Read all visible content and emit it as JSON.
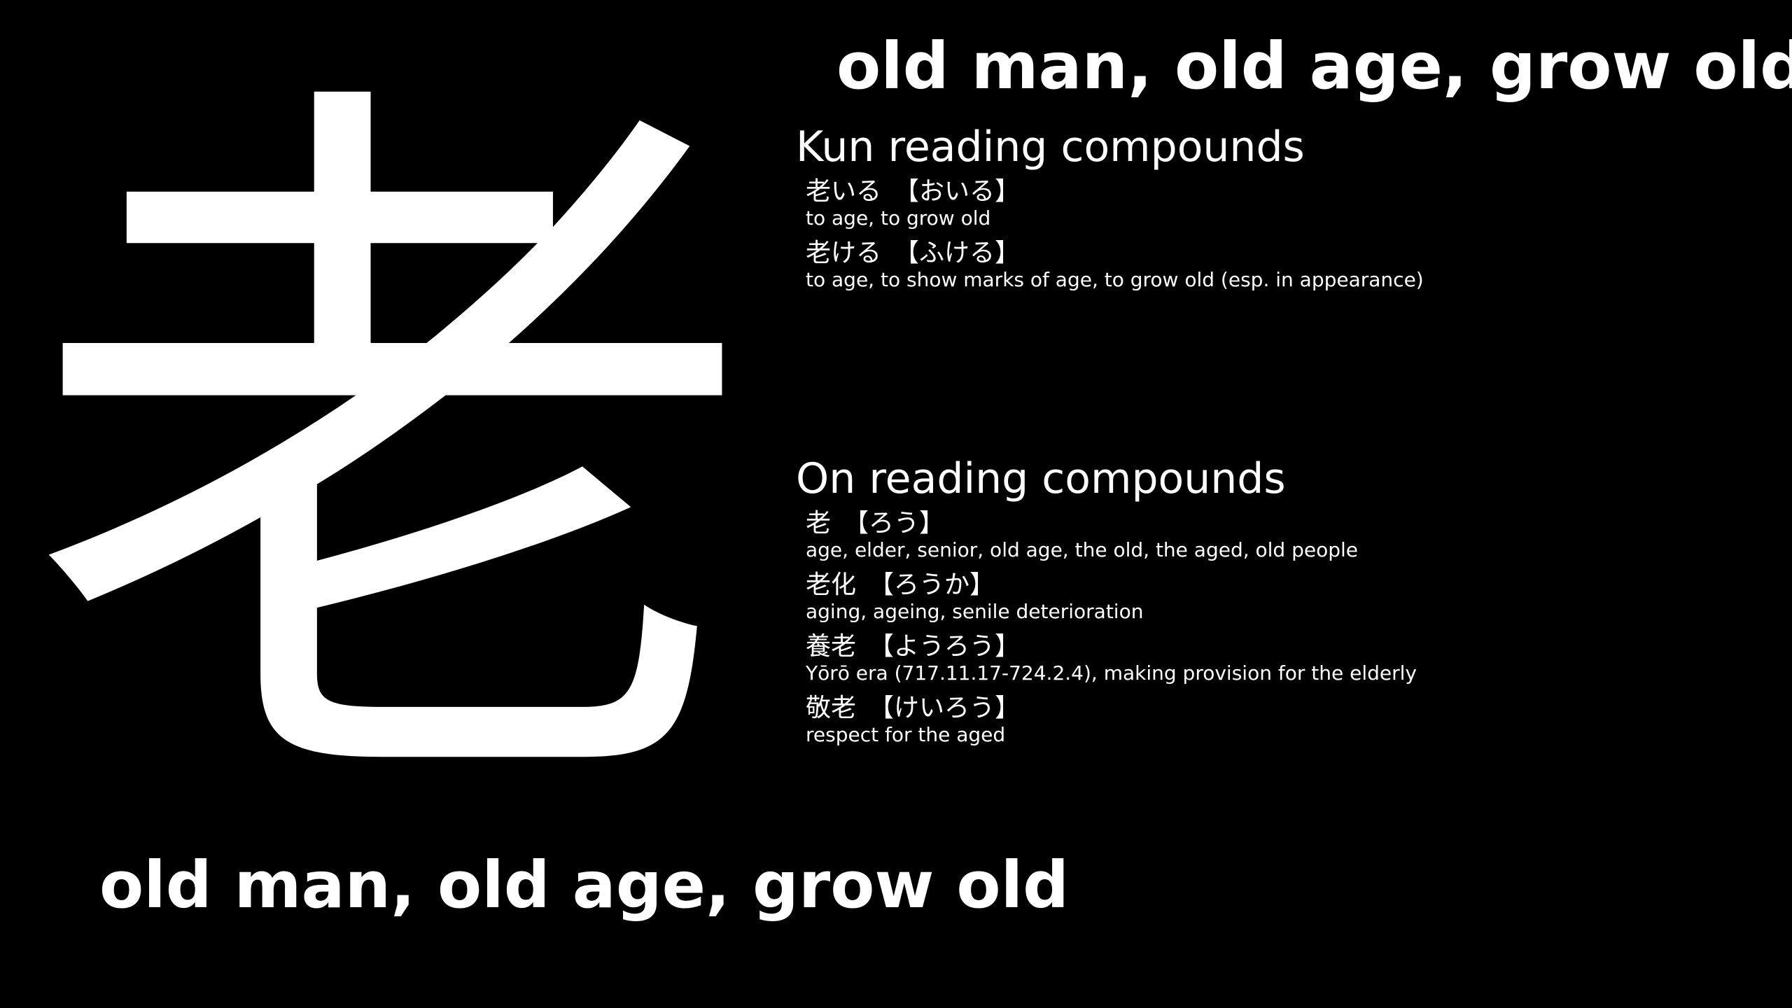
{
  "kanji": "老",
  "meaning": "old man, old age, grow old",
  "kun": {
    "heading": "Kun reading compounds",
    "compounds": [
      {
        "word": "老いる",
        "reading": "【おいる】",
        "gloss": "to age, to grow old"
      },
      {
        "word": "老ける",
        "reading": "【ふける】",
        "gloss": "to age, to show marks of age, to grow old (esp. in appearance)"
      }
    ]
  },
  "on": {
    "heading": "On reading compounds",
    "compounds": [
      {
        "word": "老",
        "reading": "【ろう】",
        "gloss": "age, elder, senior, old age, the old, the aged, old people"
      },
      {
        "word": "老化",
        "reading": "【ろうか】",
        "gloss": "aging, ageing, senile deterioration"
      },
      {
        "word": "養老",
        "reading": "【ようろう】",
        "gloss": "Yōrō era (717.11.17-724.2.4), making provision for the elderly"
      },
      {
        "word": "敬老",
        "reading": "【けいろう】",
        "gloss": "respect for the aged"
      }
    ]
  }
}
